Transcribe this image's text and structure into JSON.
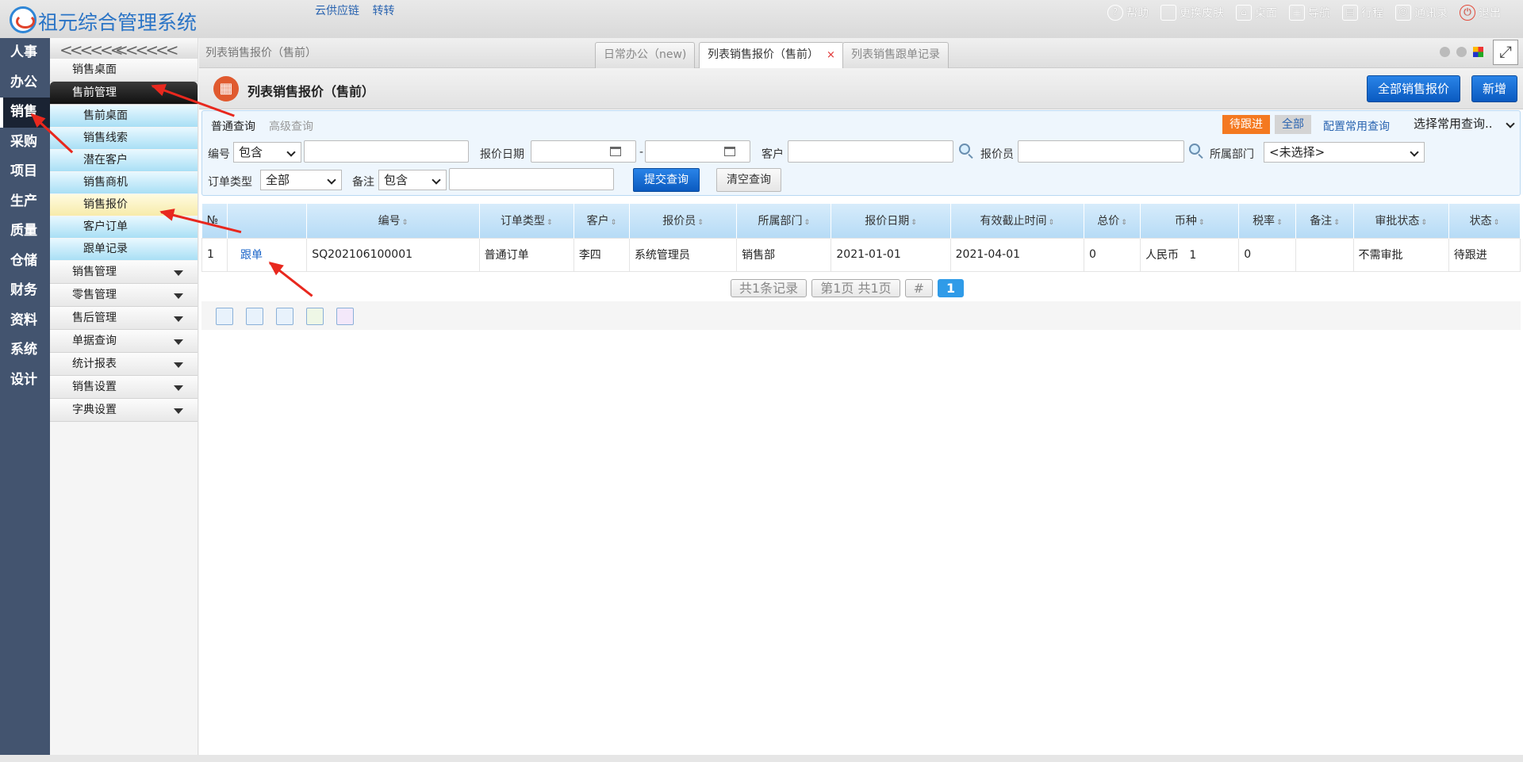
{
  "app": {
    "title": "祖元综合管理系统",
    "links": [
      "云供应链",
      "转转"
    ],
    "tools": [
      {
        "icon": "help-icon",
        "label": "帮助"
      },
      {
        "icon": "shirt-icon",
        "label": "更换皮肤"
      },
      {
        "icon": "home-icon",
        "label": "桌面"
      },
      {
        "icon": "grid-icon",
        "label": "导航"
      },
      {
        "icon": "calendar-icon",
        "label": "行程"
      },
      {
        "icon": "contacts-icon",
        "label": "通讯录"
      },
      {
        "icon": "power-icon",
        "label": "退出"
      }
    ]
  },
  "leftnav": [
    "人事",
    "办公",
    "销售",
    "采购",
    "项目",
    "生产",
    "质量",
    "仓储",
    "财务",
    "资料",
    "系统",
    "设计"
  ],
  "submenu": {
    "top_item": "销售桌面",
    "group_open": "售前管理",
    "children": [
      "售前桌面",
      "销售线索",
      "潜在客户",
      "销售商机",
      "销售报价",
      "客户订单",
      "跟单记录"
    ],
    "groups": [
      "销售管理",
      "零售管理",
      "售后管理",
      "单据查询",
      "统计报表",
      "销售设置",
      "字典设置"
    ]
  },
  "tabbar": {
    "breadcrumb": "列表销售报价（售前）",
    "tabs": [
      "日常办公（new)",
      "列表销售报价（售前）",
      "列表销售跟单记录"
    ],
    "close_glyph": "×"
  },
  "header": {
    "title": "列表销售报价（售前）",
    "btn_all": "全部销售报价",
    "btn_new": "新增"
  },
  "filter": {
    "tab_normal": "普通查询",
    "tab_advanced": "高级查询",
    "tag_pending": "待跟进",
    "tag_all": "全部",
    "config_link": "配置常用查询",
    "common_select": "选择常用查询..",
    "label_code": "编号",
    "sel_code": "包含",
    "label_date": "报价日期",
    "date_dash": "-",
    "label_customer": "客户",
    "label_quoter": "报价员",
    "label_dept": "所属部门",
    "sel_dept": "<未选择>",
    "label_ordertype": "订单类型",
    "sel_ordertype": "全部",
    "label_remark": "备注",
    "sel_remark": "包含",
    "btn_submit": "提交查询",
    "btn_clear": "清空查询"
  },
  "table": {
    "headers": [
      "№",
      "",
      "编号",
      "订单类型",
      "客户",
      "报价员",
      "所属部门",
      "报价日期",
      "有效截止时间",
      "总价",
      "币种",
      "税率",
      "备注",
      "审批状态",
      "状态"
    ],
    "sort_glyph": "⇕",
    "rows": [
      [
        "1",
        "跟单",
        "SQ202106100001",
        "普通订单",
        "李四",
        "系统管理员",
        "销售部",
        "2021-01-01",
        "2021-04-01",
        "0",
        "人民币   1",
        "0",
        "",
        "不需审批",
        "待跟进"
      ]
    ]
  },
  "pager": {
    "total": "共1条记录",
    "page": "第1页 共1页",
    "hash": "#",
    "current": "1"
  }
}
